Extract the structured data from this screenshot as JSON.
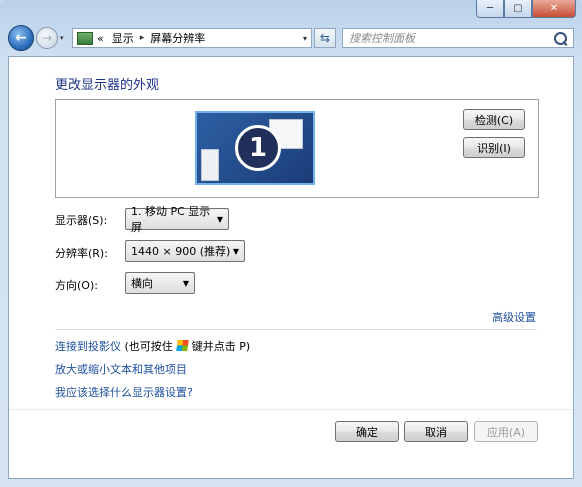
{
  "window": {
    "min_label": "─",
    "max_label": "▢",
    "close_label": "✕"
  },
  "nav": {
    "back_glyph": "←",
    "forward_glyph": "→",
    "dropdown_glyph": "▾",
    "breadcrumb_prefix": "«",
    "crumb1": "显示",
    "crumb_sep": "▸",
    "crumb2": "屏幕分辨率",
    "address_drop": "▾",
    "refresh_glyph": "⇆",
    "search_placeholder": "搜索控制面板"
  },
  "main": {
    "title": "更改显示器的外观",
    "monitor_number": "1",
    "detect_button": "检测(C)",
    "identify_button": "识别(I)",
    "display_label": "显示器(S):",
    "display_value": "1. 移动 PC 显示屏",
    "resolution_label": "分辨率(R):",
    "resolution_value": "1440 × 900 (推荐)",
    "orientation_label": "方向(O):",
    "orientation_value": "横向",
    "advanced_link": "高级设置",
    "projector_link": "连接到投影仪",
    "projector_hint_pre": "(也可按住",
    "projector_hint_post": "键并点击 P)",
    "text_size_link": "放大或缩小文本和其他项目",
    "help_link": "我应该选择什么显示器设置?"
  },
  "footer": {
    "ok_button": "确定",
    "cancel_button": "取消",
    "apply_button": "应用(A)"
  }
}
